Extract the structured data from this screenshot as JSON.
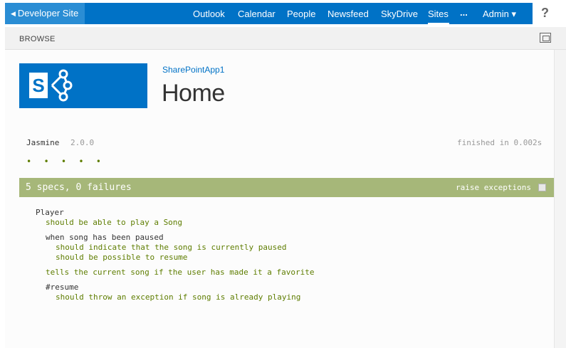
{
  "suitebar": {
    "back_label": "Developer Site",
    "nav": [
      "Outlook",
      "Calendar",
      "People",
      "Newsfeed",
      "SkyDrive",
      "Sites",
      "...",
      "Admin ▾"
    ],
    "help": "?"
  },
  "ribbon": {
    "browse_label": "BROWSE"
  },
  "site": {
    "link": "SharePointApp1",
    "title": "Home"
  },
  "jasmine": {
    "title": "Jasmine",
    "version": "2.0.0",
    "finished": "finished in 0.002s",
    "dots": "• • • • •",
    "summary": "5 specs, 0 failures",
    "raise_label": "raise exceptions",
    "results": [
      {
        "text": "Player",
        "kind": "suite"
      },
      {
        "text": "should be able to play a Song",
        "kind": "spec"
      },
      {
        "text": "when song has been paused",
        "kind": "suite"
      },
      {
        "text": "should indicate that the song is currently paused",
        "kind": "spec"
      },
      {
        "text": "should be possible to resume",
        "kind": "spec"
      },
      {
        "text": "tells the current song if the user has made it a favorite",
        "kind": "spec"
      },
      {
        "text": "#resume",
        "kind": "suite"
      },
      {
        "text": "should throw an exception if song is already playing",
        "kind": "spec"
      }
    ]
  },
  "colors": {
    "brand": "#0072c6",
    "pass": "#5e7d00",
    "summary_bg": "#a6b779"
  }
}
